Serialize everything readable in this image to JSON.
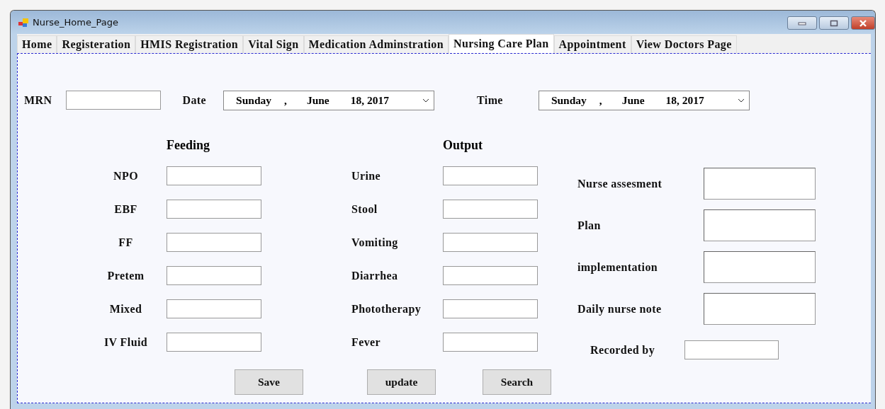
{
  "window": {
    "title": "Nurse_Home_Page"
  },
  "tabs": [
    {
      "label": "Home",
      "selected": false
    },
    {
      "label": "Registeration",
      "selected": false
    },
    {
      "label": "HMIS Registration",
      "selected": false
    },
    {
      "label": "Vital Sign",
      "selected": false
    },
    {
      "label": "Medication Adminstration",
      "selected": false
    },
    {
      "label": "Nursing Care Plan",
      "selected": true
    },
    {
      "label": "Appointment",
      "selected": false
    },
    {
      "label": "View Doctors Page",
      "selected": false
    }
  ],
  "mrn": {
    "label": "MRN"
  },
  "date": {
    "label": "Date",
    "value": [
      "Sunday",
      ",",
      "June",
      "18, 2017"
    ]
  },
  "time": {
    "label": "Time",
    "value": [
      "Sunday",
      ",",
      "June",
      "18, 2017"
    ]
  },
  "feeding": {
    "heading": "Feeding",
    "fields": [
      {
        "label": "NPO"
      },
      {
        "label": "EBF"
      },
      {
        "label": "FF"
      },
      {
        "label": "Pretem"
      },
      {
        "label": "Mixed"
      },
      {
        "label": "IV Fluid"
      }
    ]
  },
  "output": {
    "heading": "Output",
    "fields": [
      {
        "label": "Urine"
      },
      {
        "label": "Stool"
      },
      {
        "label": "Vomiting"
      },
      {
        "label": "Diarrhea"
      },
      {
        "label": "Phototherapy"
      },
      {
        "label": "Fever"
      }
    ]
  },
  "notes": [
    {
      "label": "Nurse assesment"
    },
    {
      "label": "Plan"
    },
    {
      "label": "implementation"
    },
    {
      "label": "Daily nurse note"
    }
  ],
  "recorded_by": {
    "label": "Recorded by"
  },
  "buttons": [
    "Save",
    "update",
    "Search"
  ]
}
